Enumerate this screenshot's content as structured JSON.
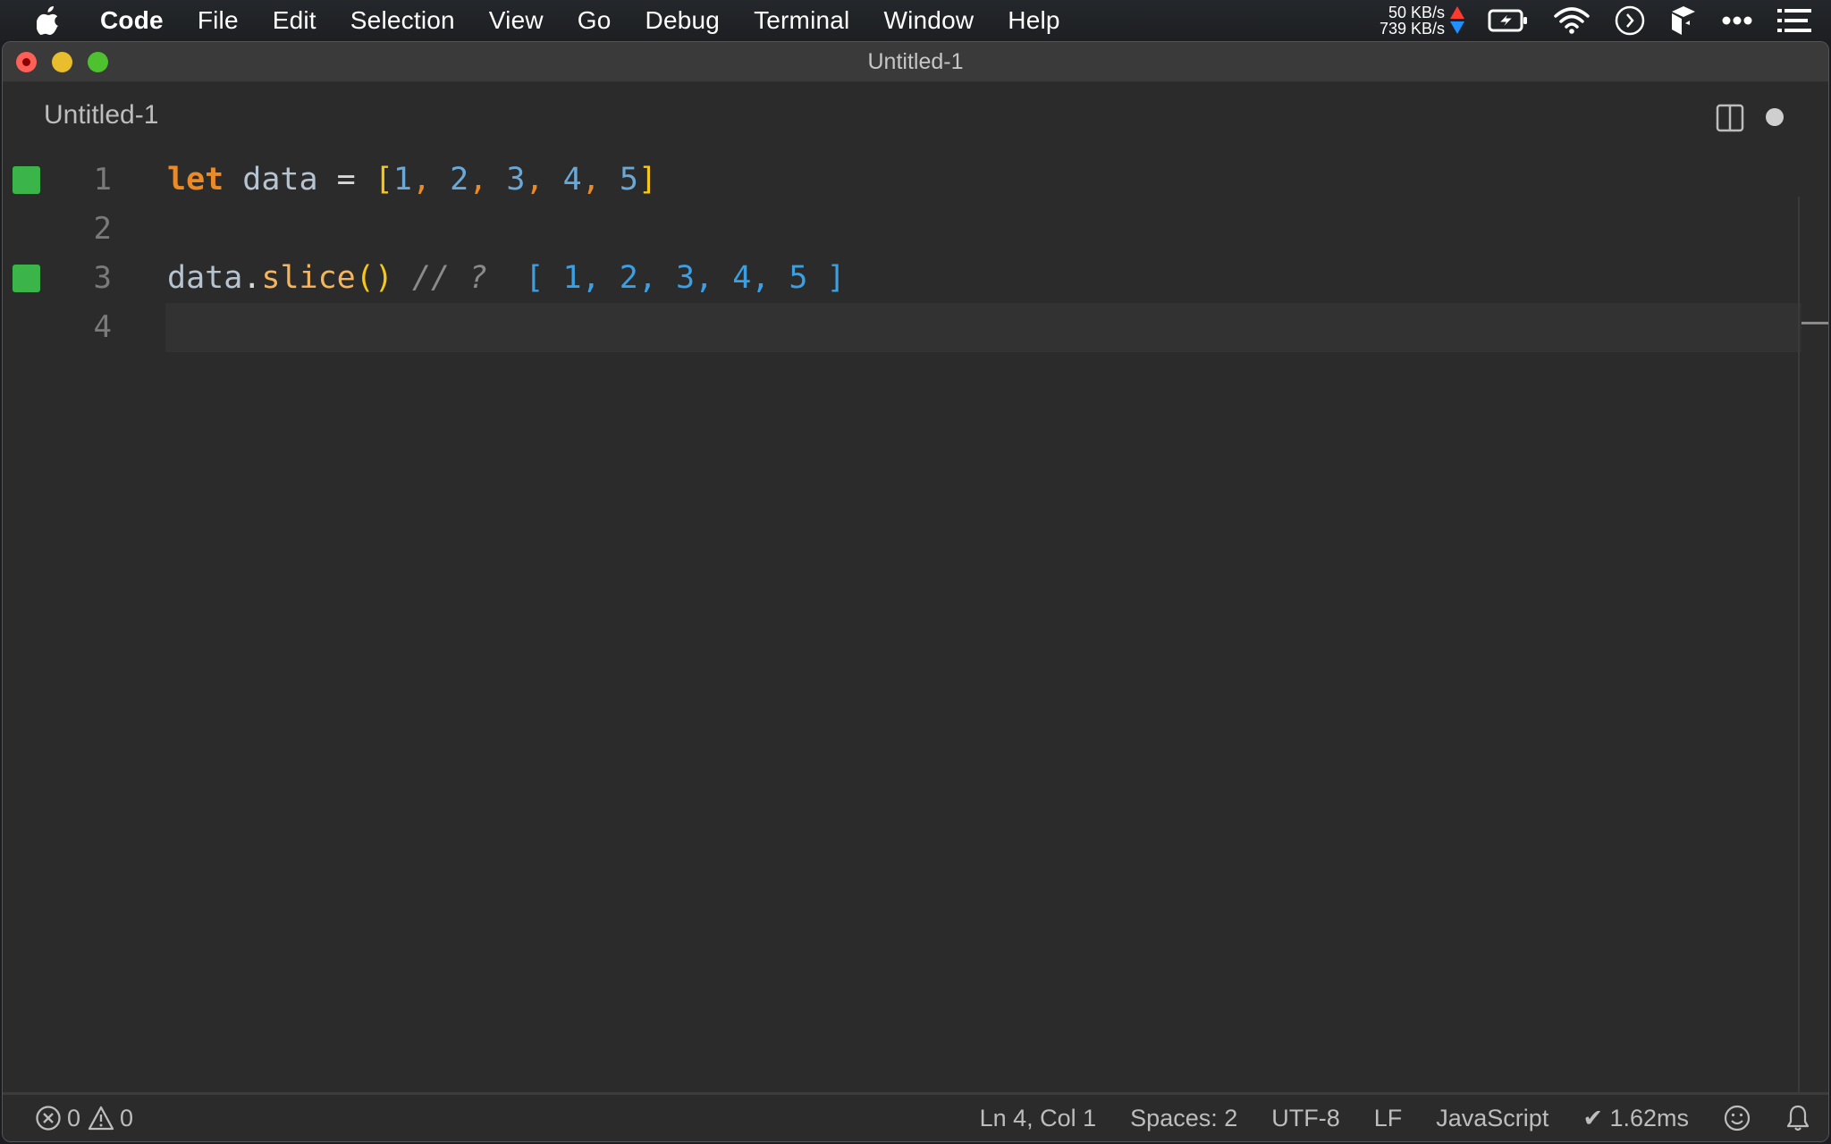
{
  "menubar": {
    "app_name": "Code",
    "items": [
      "File",
      "Edit",
      "Selection",
      "View",
      "Go",
      "Debug",
      "Terminal",
      "Window",
      "Help"
    ],
    "network": {
      "upload": "50 KB/s",
      "download": "739 KB/s"
    },
    "tray_icons": [
      "battery-charging-icon",
      "wifi-icon",
      "chevron-circle-icon",
      "cube-app-icon",
      "more-icon",
      "list-icon"
    ]
  },
  "window": {
    "title": "Untitled-1",
    "tab": {
      "label": "Untitled-1",
      "dirty": true
    }
  },
  "editor": {
    "lines": [
      {
        "number": "1",
        "marker": true,
        "tokens": [
          {
            "t": "let",
            "c": "kw"
          },
          {
            "t": " data ",
            "c": "ident"
          },
          {
            "t": "=",
            "c": "op"
          },
          {
            "t": " ",
            "c": "op"
          },
          {
            "t": "[",
            "c": "br-y"
          },
          {
            "t": "1",
            "c": "num"
          },
          {
            "t": ",",
            "c": "comma"
          },
          {
            "t": " ",
            "c": "op"
          },
          {
            "t": "2",
            "c": "num"
          },
          {
            "t": ",",
            "c": "comma"
          },
          {
            "t": " ",
            "c": "op"
          },
          {
            "t": "3",
            "c": "num"
          },
          {
            "t": ",",
            "c": "comma"
          },
          {
            "t": " ",
            "c": "op"
          },
          {
            "t": "4",
            "c": "num"
          },
          {
            "t": ",",
            "c": "comma"
          },
          {
            "t": " ",
            "c": "op"
          },
          {
            "t": "5",
            "c": "num"
          },
          {
            "t": "]",
            "c": "br-y"
          }
        ]
      },
      {
        "number": "2",
        "marker": false,
        "tokens": []
      },
      {
        "number": "3",
        "marker": true,
        "tokens": [
          {
            "t": "data",
            "c": "ident"
          },
          {
            "t": ".",
            "c": "op"
          },
          {
            "t": "slice",
            "c": "fn"
          },
          {
            "t": "()",
            "c": "br-y"
          },
          {
            "t": " // ? ",
            "c": "cmt"
          },
          {
            "t": " [ 1, 2, 3, 4, 5 ]",
            "c": "res"
          }
        ]
      },
      {
        "number": "4",
        "marker": false,
        "current": true,
        "tokens": []
      }
    ],
    "marker_color": "#3bb54a"
  },
  "statusbar": {
    "errors": "0",
    "warnings": "0",
    "position": "Ln 4, Col 1",
    "indent": "Spaces: 2",
    "encoding": "UTF-8",
    "eol": "LF",
    "language": "JavaScript",
    "timing": "✔ 1.62ms"
  }
}
